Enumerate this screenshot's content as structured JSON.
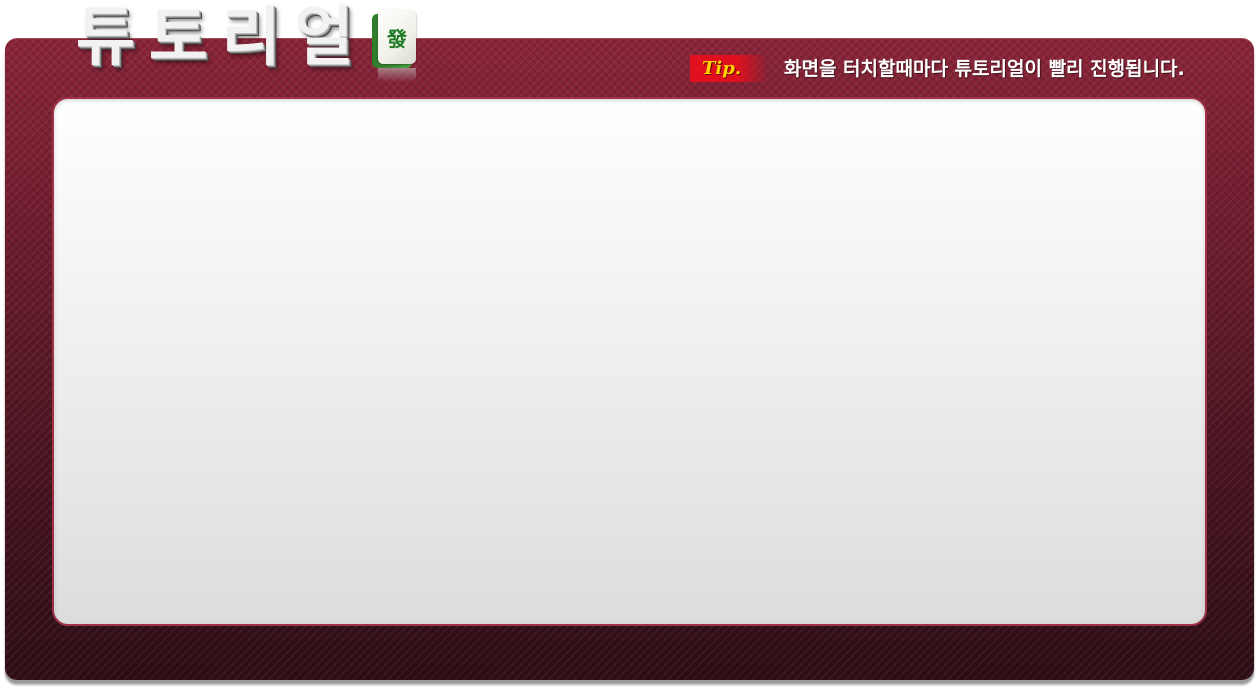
{
  "header": {
    "title": "튜토리얼",
    "tile_icon": "mahjong-green-dragon-tile-icon",
    "tile_glyph": "發"
  },
  "tip": {
    "badge_label": "Tip.",
    "message": "화면을 터치할때마다 튜토리얼이 빨리 진행됩니다."
  },
  "colors": {
    "frame": "#6e1c2d",
    "frame_dark": "#2e0d15",
    "panel_border": "#9e3347",
    "tip_badge": "#e0101e",
    "tip_label": "#ffd200",
    "tile_green": "#1f7a24"
  }
}
